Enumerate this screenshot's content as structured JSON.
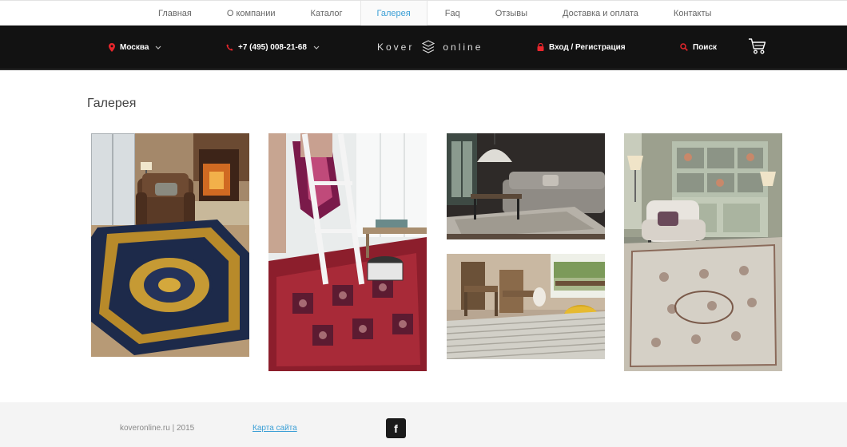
{
  "topnav": {
    "items": [
      {
        "label": "Главная"
      },
      {
        "label": "О компании"
      },
      {
        "label": "Каталог"
      },
      {
        "label": "Галерея",
        "active": true
      },
      {
        "label": "Faq"
      },
      {
        "label": "Отзывы"
      },
      {
        "label": "Доставка и оплата"
      },
      {
        "label": "Контакты"
      }
    ]
  },
  "header": {
    "city": "Москва",
    "phone": "+7 (495) 008-21-68",
    "logo_left": "Kover",
    "logo_right": "online",
    "login": "Вход / Регистрация",
    "search": "Поиск",
    "accent_color": "#e8262c"
  },
  "page": {
    "title": "Галерея"
  },
  "gallery": {
    "images": [
      {
        "name": "living-room-fireplace-rug-photo"
      },
      {
        "name": "red-persian-rug-ladder-photo"
      },
      {
        "name": "dark-living-room-sofa-photo"
      },
      {
        "name": "striped-rug-wooden-chairs-photo"
      },
      {
        "name": "white-armchair-beige-rug-photo"
      }
    ]
  },
  "footer": {
    "copyright": "koveronline.ru | 2015",
    "sitemap": "Карта сайта",
    "facebook": "f"
  }
}
